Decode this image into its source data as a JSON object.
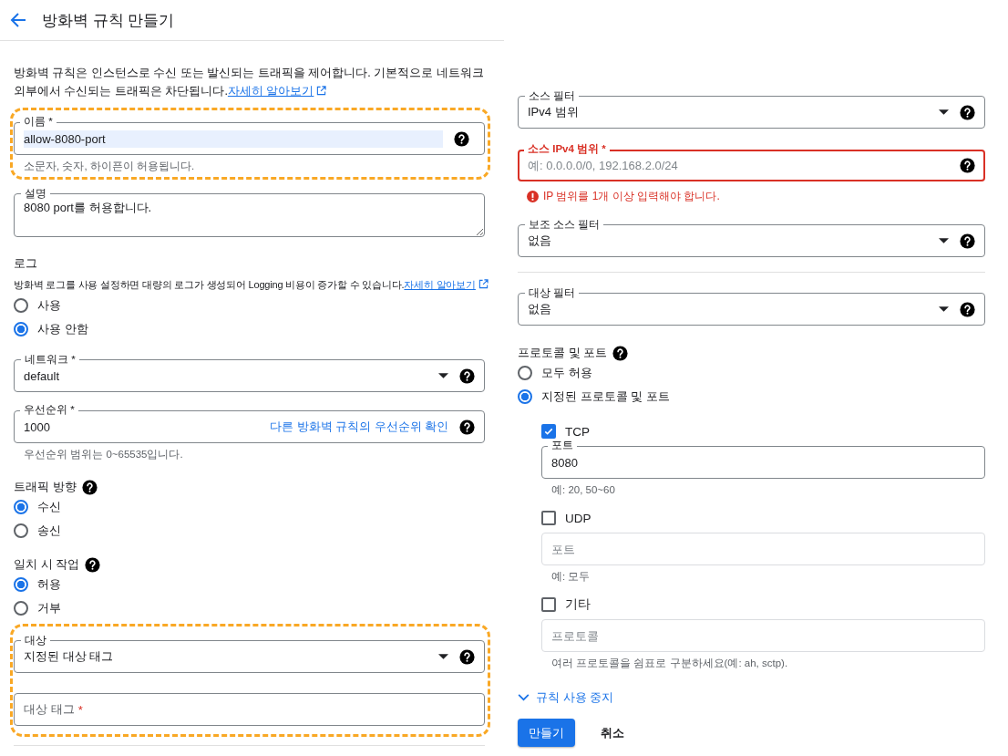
{
  "header": {
    "title": "방화벽 규칙 만들기"
  },
  "intro": {
    "text": "방화벽 규칙은 인스턴스로 수신 또는 발신되는 트래픽을 제어합니다. 기본적으로 네트워크 외부에서 수신되는 트래픽은 차단됩니다.",
    "link": "자세히 알아보기"
  },
  "name_field": {
    "label": "이름 *",
    "value": "allow-8080-port",
    "hint": "소문자, 숫자, 하이픈이 허용됩니다.",
    "highlighted": true
  },
  "description": {
    "label": "설명",
    "value": "8080 port를 허용합니다."
  },
  "logs": {
    "title": "로그",
    "text": "방화벽 로그를 사용 설정하면 대량의 로그가 생성되어 Logging 비용이 증가할 수 있습니다.",
    "link": "자세히 알아보기",
    "options": [
      {
        "label": "사용",
        "selected": false
      },
      {
        "label": "사용 안함",
        "selected": true
      }
    ]
  },
  "network": {
    "label": "네트워크 *",
    "value": "default"
  },
  "priority": {
    "label": "우선순위 *",
    "value": "1000",
    "link": "다른 방화벽 규칙의 우선순위 확인",
    "hint": "우선순위 범위는 0~65535입니다."
  },
  "direction": {
    "title": "트래픽 방향",
    "options": [
      {
        "label": "수신",
        "selected": true
      },
      {
        "label": "송신",
        "selected": false
      }
    ]
  },
  "action": {
    "title": "일치 시 작업",
    "options": [
      {
        "label": "허용",
        "selected": true
      },
      {
        "label": "거부",
        "selected": false
      }
    ]
  },
  "target": {
    "label": "대상",
    "value": "지정된 대상 태그",
    "tag_placeholder": "대상 태그",
    "required_mark": "*",
    "highlighted": true
  },
  "source_filter": {
    "label": "소스 필터",
    "value": "IPv4 범위"
  },
  "source_ranges": {
    "label": "소스 IPv4 범위 *",
    "placeholder": "예: 0.0.0.0/0, 192.168.2.0/24",
    "error": "IP 범위를 1개 이상 입력해야 합니다.",
    "invalid": true
  },
  "secondary_filter": {
    "label": "보조 소스 필터",
    "value": "없음"
  },
  "target_filter": {
    "label": "대상 필터",
    "value": "없음"
  },
  "protocols": {
    "title": "프로토콜 및 포트",
    "options": [
      {
        "label": "모두 허용",
        "selected": false
      },
      {
        "label": "지정된 프로토콜 및 포트",
        "selected": true
      }
    ],
    "items": [
      {
        "label": "TCP",
        "checked": true,
        "field_label": "포트",
        "value": "8080",
        "hint": "예: 20, 50~60"
      },
      {
        "label": "UDP",
        "checked": false,
        "placeholder": "포트",
        "hint": "예: 모두"
      },
      {
        "label": "기타",
        "checked": false,
        "placeholder": "프로토콜",
        "hint": "여러 프로토콜을 쉼표로 구분하세요(예: ah, sctp)."
      }
    ]
  },
  "disable_rule": {
    "label": "규칙 사용 중지",
    "expanded": false
  },
  "buttons": {
    "create": "만들기",
    "cancel": "취소"
  }
}
